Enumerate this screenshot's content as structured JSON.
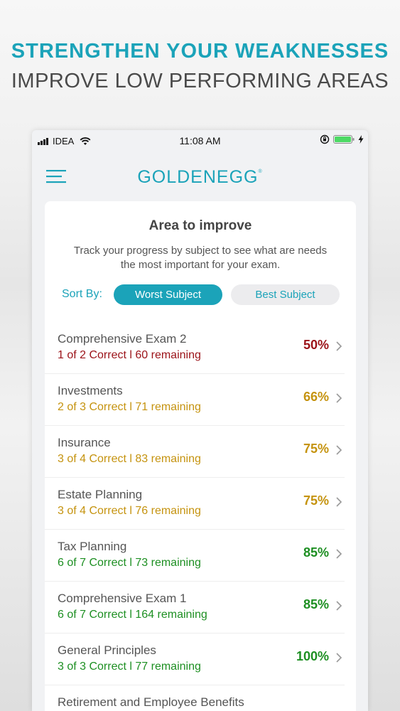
{
  "promo": {
    "headline": "STRENGTHEN YOUR WEAKNESSES",
    "subheadline": "IMPROVE LOW PERFORMING AREAS"
  },
  "status_bar": {
    "carrier": "IDEA",
    "time": "11:08 AM"
  },
  "app": {
    "logo": "GOLDENEGG",
    "logo_mark": "®"
  },
  "card": {
    "title": "Area to improve",
    "description": "Track your progress by subject to see what are needs the most important for your exam.",
    "sort_label": "Sort By:",
    "sort_options": [
      {
        "label": "Worst Subject",
        "selected": true
      },
      {
        "label": "Best Subject",
        "selected": false
      }
    ]
  },
  "colors": {
    "accent": "#1ba3b9",
    "low": "#9b1218",
    "medium": "#c5930f",
    "high": "#1d8f22"
  },
  "subjects": [
    {
      "name": "Comprehensive Exam 2",
      "stats": "1 of 2  Correct l 60 remaining",
      "percent": "50%",
      "level": "low"
    },
    {
      "name": "Investments",
      "stats": "2 of 3  Correct l 71 remaining",
      "percent": "66%",
      "level": "medium"
    },
    {
      "name": "Insurance",
      "stats": "3 of 4  Correct l 83 remaining",
      "percent": "75%",
      "level": "medium"
    },
    {
      "name": "Estate Planning",
      "stats": "3 of 4  Correct l 76 remaining",
      "percent": "75%",
      "level": "medium"
    },
    {
      "name": "Tax Planning",
      "stats": "6 of 7  Correct l 73 remaining",
      "percent": "85%",
      "level": "high"
    },
    {
      "name": "Comprehensive Exam 1",
      "stats": "6 of 7  Correct l 164 remaining",
      "percent": "85%",
      "level": "high"
    },
    {
      "name": "General Principles",
      "stats": "3 of 3  Correct l 77 remaining",
      "percent": "100%",
      "level": "high"
    },
    {
      "name": "Retirement and Employee Benefits",
      "stats": "",
      "percent": "",
      "level": "high"
    }
  ]
}
